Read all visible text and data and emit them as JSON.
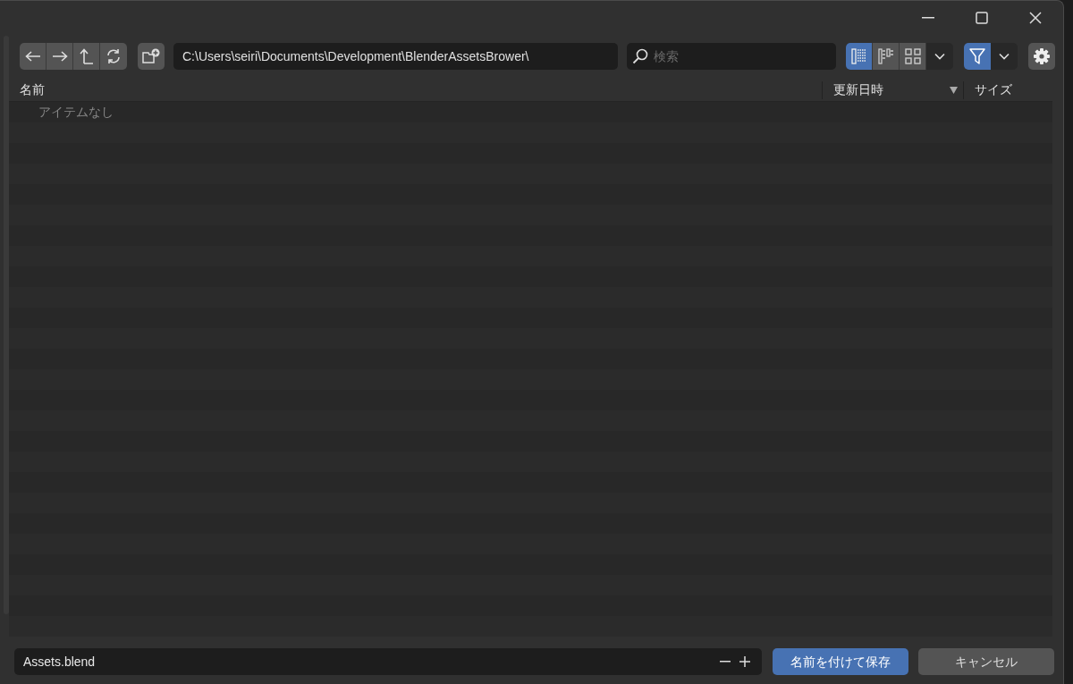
{
  "path_field": {
    "value": "C:\\Users\\seiri\\Documents\\Development\\BlenderAssetsBrower\\"
  },
  "search": {
    "placeholder": "検索"
  },
  "view_modes": [
    {
      "kind": "vertical-list",
      "selected": true
    },
    {
      "kind": "horizontal-list",
      "selected": false
    },
    {
      "kind": "thumbnails",
      "selected": false
    }
  ],
  "filter": {
    "on": true
  },
  "columns": [
    {
      "label": "名前",
      "sorted": false
    },
    {
      "label": "更新日時",
      "sorted": true
    },
    {
      "label": "サイズ",
      "sorted": false
    }
  ],
  "empty_message": "アイテムなし",
  "filename_field": {
    "value": "Assets.blend"
  },
  "buttons": [
    {
      "label": "名前を付けて保存",
      "kind": "primary"
    },
    {
      "label": "キャンセル",
      "kind": "secondary"
    }
  ]
}
